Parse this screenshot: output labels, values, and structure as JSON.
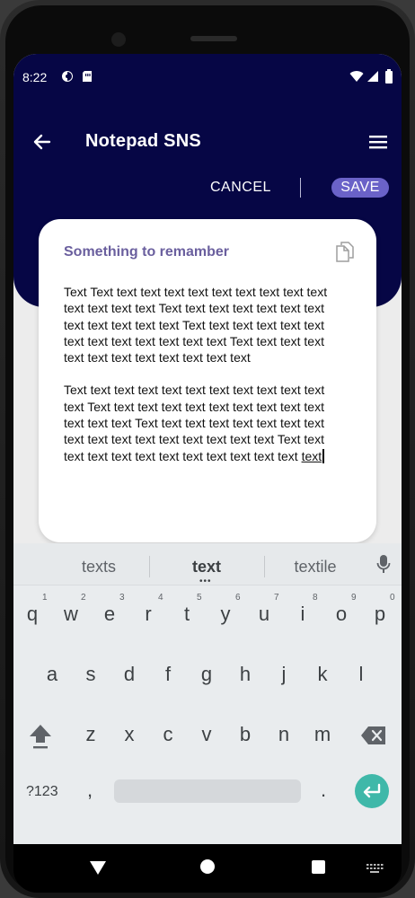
{
  "status_bar": {
    "time": "8:22"
  },
  "app": {
    "title": "Notepad SNS",
    "cancel_label": "CANCEL",
    "save_label": "SAVE"
  },
  "note": {
    "title": "Something to remamber",
    "paragraph1": "Text Text text text text text text text text text text text text text text Text text text text text text text text text text text text Text text text text text text text text text text text text text Text text text text text text text text text text text text",
    "paragraph2_start": "Text text text text text text text text text text text text Text text text text text text text text text text text text text Text text text text text text text text text text text text text text text text text Text text text text text text text text text text text text",
    "paragraph2_end": "text"
  },
  "keyboard": {
    "suggestions": [
      "texts",
      "text",
      "textile"
    ],
    "row1": [
      "q",
      "w",
      "e",
      "r",
      "t",
      "y",
      "u",
      "i",
      "o",
      "p"
    ],
    "row1_nums": [
      "1",
      "2",
      "3",
      "4",
      "5",
      "6",
      "7",
      "8",
      "9",
      "0"
    ],
    "row2": [
      "a",
      "s",
      "d",
      "f",
      "g",
      "h",
      "j",
      "k",
      "l"
    ],
    "row3": [
      "z",
      "x",
      "c",
      "v",
      "b",
      "n",
      "m"
    ],
    "symbols_label": "?123",
    "comma": ",",
    "period": "."
  },
  "colors": {
    "header_bg": "#060645",
    "accent": "#6a62c8",
    "note_title": "#6a5f9e",
    "enter_key": "#3fb8a9"
  }
}
